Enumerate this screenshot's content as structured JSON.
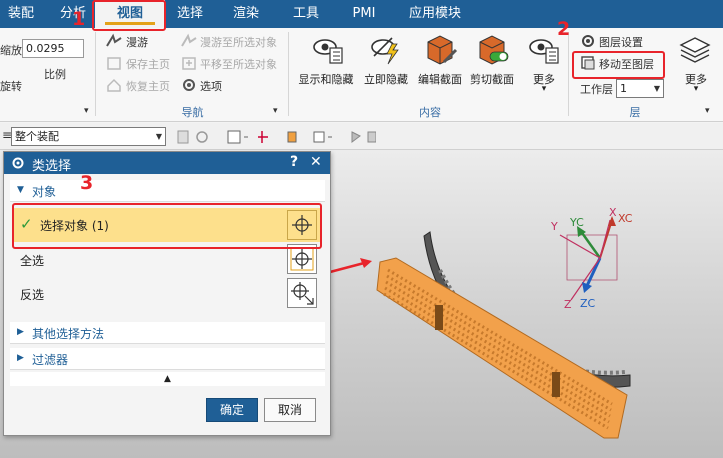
{
  "menubar": {
    "tabs": [
      {
        "label": "装配"
      },
      {
        "label": "分析"
      },
      {
        "label": "视图",
        "active": true
      },
      {
        "label": "选择"
      },
      {
        "label": "渲染"
      },
      {
        "label": "工具"
      },
      {
        "label": "PMI"
      },
      {
        "label": "应用模块"
      }
    ]
  },
  "ribbon": {
    "scale_partial": "缩放",
    "scale_value": "0.0295",
    "scale_label": "比例",
    "rotate_partial": "旋转",
    "nav": {
      "roam": "漫游",
      "roam_to_selected": "漫游至所选对象",
      "save_home": "保存主页",
      "pan_to_selected": "平移至所选对象",
      "restore_home": "恢复主页",
      "options": "选项",
      "group": "导航"
    },
    "content": {
      "show_hide": "显示和隐藏",
      "instant_hide": "立即隐藏",
      "edit_section": "编辑截面",
      "clip_section": "剪切截面",
      "more": "更多",
      "group": "内容"
    },
    "layer": {
      "layer_settings": "图层设置",
      "move_to_layer": "移动至图层",
      "work_layer_label": "工作层",
      "work_layer_value": "1",
      "more": "更多",
      "group": "层"
    }
  },
  "quickbar": {
    "filter_value": "整个装配"
  },
  "dialog": {
    "title": "类选择",
    "help": "?",
    "close": "✕",
    "section_object": "对象",
    "select_object": "选择对象 (1)",
    "select_all": "全选",
    "invert": "反选",
    "section_other": "其他选择方法",
    "section_filter": "过滤器",
    "ok": "确定",
    "cancel": "取消"
  },
  "triad": {
    "xc": "XC",
    "yc": "YC",
    "zc": "ZC",
    "x": "X",
    "y": "Y",
    "z": "Z"
  },
  "annotations": {
    "n1": "1",
    "n2": "2",
    "n3": "3",
    "color": "#e8242b"
  },
  "colors": {
    "menubar": "#1f5f96",
    "accent_underline": "#e3a21a",
    "selection_row": "#fde08c",
    "part_orange": "#f2a14b",
    "ok_button": "#1f5f96"
  }
}
